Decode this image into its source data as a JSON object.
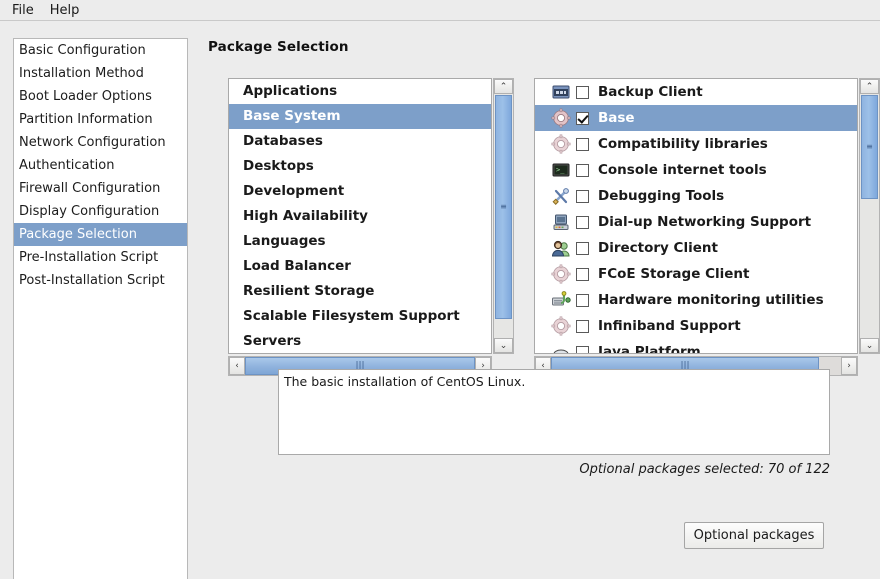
{
  "menubar": {
    "items": [
      {
        "label": "File"
      },
      {
        "label": "Help"
      }
    ]
  },
  "sidebar": {
    "items": [
      {
        "label": "Basic Configuration",
        "selected": false
      },
      {
        "label": "Installation Method",
        "selected": false
      },
      {
        "label": "Boot Loader Options",
        "selected": false
      },
      {
        "label": "Partition Information",
        "selected": false
      },
      {
        "label": "Network Configuration",
        "selected": false
      },
      {
        "label": "Authentication",
        "selected": false
      },
      {
        "label": "Firewall Configuration",
        "selected": false
      },
      {
        "label": "Display Configuration",
        "selected": false
      },
      {
        "label": "Package Selection",
        "selected": true
      },
      {
        "label": "Pre-Installation Script",
        "selected": false
      },
      {
        "label": "Post-Installation Script",
        "selected": false
      }
    ]
  },
  "main": {
    "title": "Package Selection",
    "categories": [
      {
        "label": "Applications",
        "selected": false
      },
      {
        "label": "Base System",
        "selected": true
      },
      {
        "label": "Databases",
        "selected": false
      },
      {
        "label": "Desktops",
        "selected": false
      },
      {
        "label": "Development",
        "selected": false
      },
      {
        "label": "High Availability",
        "selected": false
      },
      {
        "label": "Languages",
        "selected": false
      },
      {
        "label": "Load Balancer",
        "selected": false
      },
      {
        "label": "Resilient Storage",
        "selected": false
      },
      {
        "label": "Scalable Filesystem Support",
        "selected": false
      },
      {
        "label": "Servers",
        "selected": false
      }
    ],
    "packages": [
      {
        "label": "Backup Client",
        "checked": false,
        "selected": false,
        "icon": "package-window-icon"
      },
      {
        "label": "Base",
        "checked": true,
        "selected": true,
        "icon": "gear-icon"
      },
      {
        "label": "Compatibility libraries",
        "checked": false,
        "selected": false,
        "icon": "gear-icon"
      },
      {
        "label": "Console internet tools",
        "checked": false,
        "selected": false,
        "icon": "terminal-icon"
      },
      {
        "label": "Debugging Tools",
        "checked": false,
        "selected": false,
        "icon": "tools-icon"
      },
      {
        "label": "Dial-up Networking Support",
        "checked": false,
        "selected": false,
        "icon": "telephone-icon"
      },
      {
        "label": "Directory Client",
        "checked": false,
        "selected": false,
        "icon": "users-icon"
      },
      {
        "label": "FCoE Storage Client",
        "checked": false,
        "selected": false,
        "icon": "gear-icon"
      },
      {
        "label": "Hardware monitoring utilities",
        "checked": false,
        "selected": false,
        "icon": "hardware-monitor-icon"
      },
      {
        "label": "Infiniband Support",
        "checked": false,
        "selected": false,
        "icon": "gear-icon"
      },
      {
        "label": "Java Platform",
        "checked": false,
        "selected": false,
        "icon": "java-icon"
      }
    ],
    "description": "The basic installation of CentOS Linux.",
    "optional_status": "Optional packages selected: 70 of 122",
    "optional_button": "Optional packages"
  },
  "scrollbars": {
    "up_arrow": "⌃",
    "down_arrow": "⌄",
    "left_arrow": "‹",
    "right_arrow": "›",
    "grip": "⫴"
  },
  "colors": {
    "selection": "#7d9fc9",
    "window_bg": "#ececec",
    "list_bg": "#ffffff",
    "scroll_thumb": "#8fb2dd"
  }
}
